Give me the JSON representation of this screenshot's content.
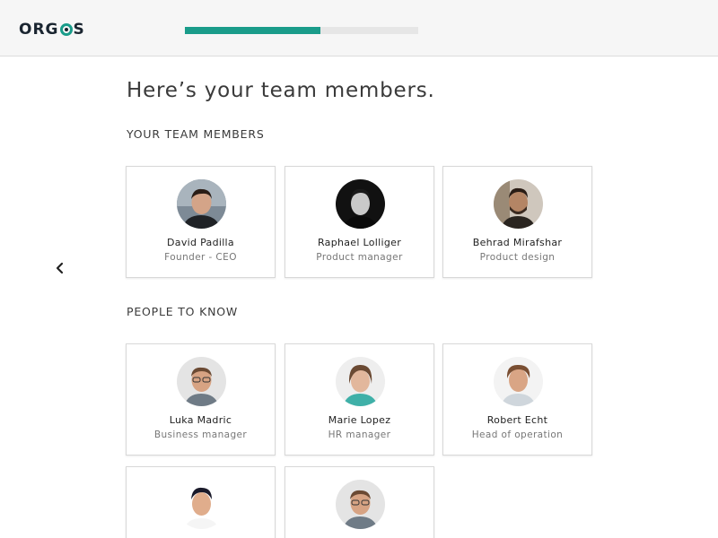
{
  "header": {
    "logo_text": "ORGOS",
    "onboarding_progress_fraction": 0.58,
    "accent_color": "#1a9c8a"
  },
  "main": {
    "title": "Here’s your team members.",
    "team_section": {
      "label": "YOUR TEAM MEMBERS",
      "members": [
        {
          "name": "David Padilla",
          "role": "Founder - CEO"
        },
        {
          "name": "Raphael Lolliger",
          "role": "Product manager"
        },
        {
          "name": "Behrad Mirafshar",
          "role": "Product design"
        }
      ]
    },
    "people_section": {
      "label": "PEOPLE TO KNOW",
      "people": [
        {
          "name": "Luka Madric",
          "role": "Business manager"
        },
        {
          "name": "Marie Lopez",
          "role": "HR manager"
        },
        {
          "name": "Robert Echt",
          "role": "Head of operation"
        },
        {
          "name": "",
          "role": ""
        },
        {
          "name": "",
          "role": ""
        }
      ]
    }
  },
  "nav": {
    "back_icon": "chevron-left-icon"
  }
}
